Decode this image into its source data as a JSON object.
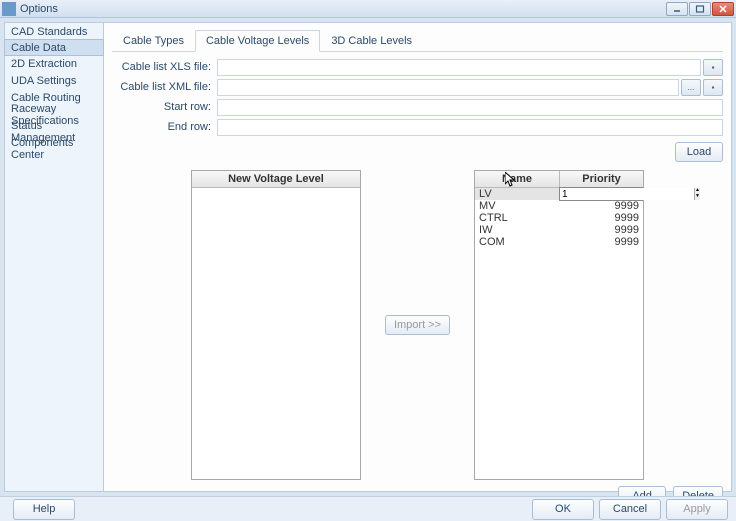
{
  "window": {
    "title": "Options"
  },
  "sidebar": {
    "items": [
      {
        "label": "CAD Standards",
        "selected": false
      },
      {
        "label": "Cable Data",
        "selected": true
      },
      {
        "label": "2D Extraction",
        "selected": false
      },
      {
        "label": "UDA Settings",
        "selected": false
      },
      {
        "label": "Cable Routing",
        "selected": false
      },
      {
        "label": "Raceway Specifications",
        "selected": false
      },
      {
        "label": "Status Management",
        "selected": false
      },
      {
        "label": "Components Center",
        "selected": false
      }
    ]
  },
  "tabs": [
    {
      "label": "Cable Types",
      "active": false
    },
    {
      "label": "Cable Voltage Levels",
      "active": true
    },
    {
      "label": "3D Cable Levels",
      "active": false
    }
  ],
  "form": {
    "xls_label": "Cable list XLS file:",
    "xls_value": "",
    "xml_label": "Cable list XML file:",
    "xml_value": "",
    "browse_xml_text": "...",
    "start_row_label": "Start row:",
    "start_row_value": "",
    "end_row_label": "End row:",
    "end_row_value": "",
    "load_label": "Load"
  },
  "left_list": {
    "header": "New Voltage Level"
  },
  "import_btn": "Import >>",
  "right_list": {
    "col1": "Name",
    "col2": "Priority",
    "rows": [
      {
        "name": "LV",
        "priority": "1",
        "editing": true
      },
      {
        "name": "MV",
        "priority": "9999"
      },
      {
        "name": "CTRL",
        "priority": "9999"
      },
      {
        "name": "IW",
        "priority": "9999"
      },
      {
        "name": "COM",
        "priority": "9999"
      }
    ]
  },
  "rb": {
    "add": "Add",
    "delete": "Delete"
  },
  "footer": {
    "help": "Help",
    "ok": "OK",
    "cancel": "Cancel",
    "apply": "Apply"
  }
}
